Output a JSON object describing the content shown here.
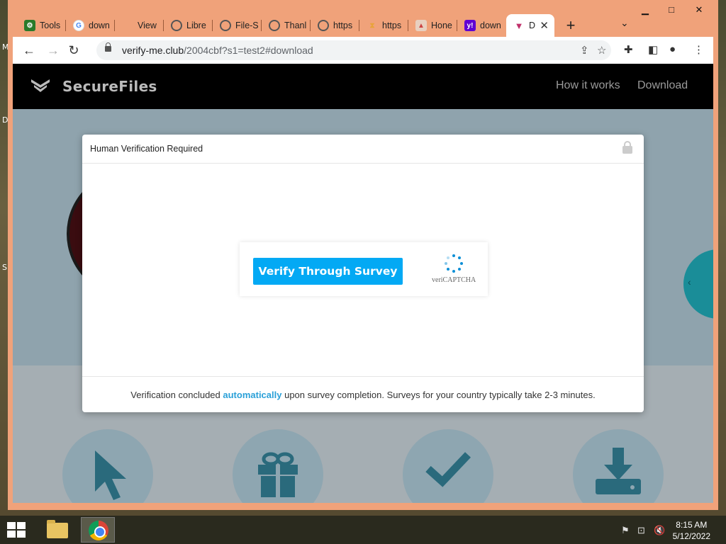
{
  "desktop": {
    "edge_letters": [
      "M",
      "D",
      "S"
    ]
  },
  "browser": {
    "tabs": [
      {
        "label": "Tools",
        "icon": "gear-icon",
        "color": "#2a7a2a"
      },
      {
        "label": "down",
        "icon": "google-icon",
        "color": "#4285f4"
      },
      {
        "label": "View",
        "icon": "blank-icon",
        "color": ""
      },
      {
        "label": "Libre",
        "icon": "globe-icon",
        "color": "#555"
      },
      {
        "label": "File-S",
        "icon": "globe-icon",
        "color": "#555"
      },
      {
        "label": "Thanl",
        "icon": "globe-icon",
        "color": "#555"
      },
      {
        "label": "https",
        "icon": "globe-icon",
        "color": "#555"
      },
      {
        "label": "https",
        "icon": "hourglass-icon",
        "color": "#e8a33a"
      },
      {
        "label": "Hone",
        "icon": "image-icon",
        "color": "#cc4444"
      },
      {
        "label": "down",
        "icon": "yahoo-icon",
        "color": "#6001d2"
      },
      {
        "label": "D",
        "icon": "v-logo-icon",
        "color": "#c0306a",
        "active": true
      }
    ],
    "new_tab": "+",
    "url": {
      "host": "verify-me.club",
      "path": "/2004cbf?s1=test2#download"
    }
  },
  "site": {
    "brand": "SecureFiles",
    "nav": [
      "How it works",
      "Download"
    ]
  },
  "modal": {
    "title": "Human Verification Required",
    "button": "Verify Through Survey",
    "captcha_brand": "veriCAPTCHA",
    "footer_before": "Verification concluded ",
    "footer_highlight": "automatically",
    "footer_after": " upon survey completion. Surveys for your country typically take 2-3 minutes."
  },
  "steps": [
    "cursor-icon",
    "gift-icon",
    "check-icon",
    "download-icon"
  ],
  "taskbar": {
    "time": "8:15 AM",
    "date": "5/12/2022"
  },
  "colors": {
    "accent": "#03a9f4",
    "highlight": "#2aa0d8",
    "window_frame": "#f0a27a"
  }
}
